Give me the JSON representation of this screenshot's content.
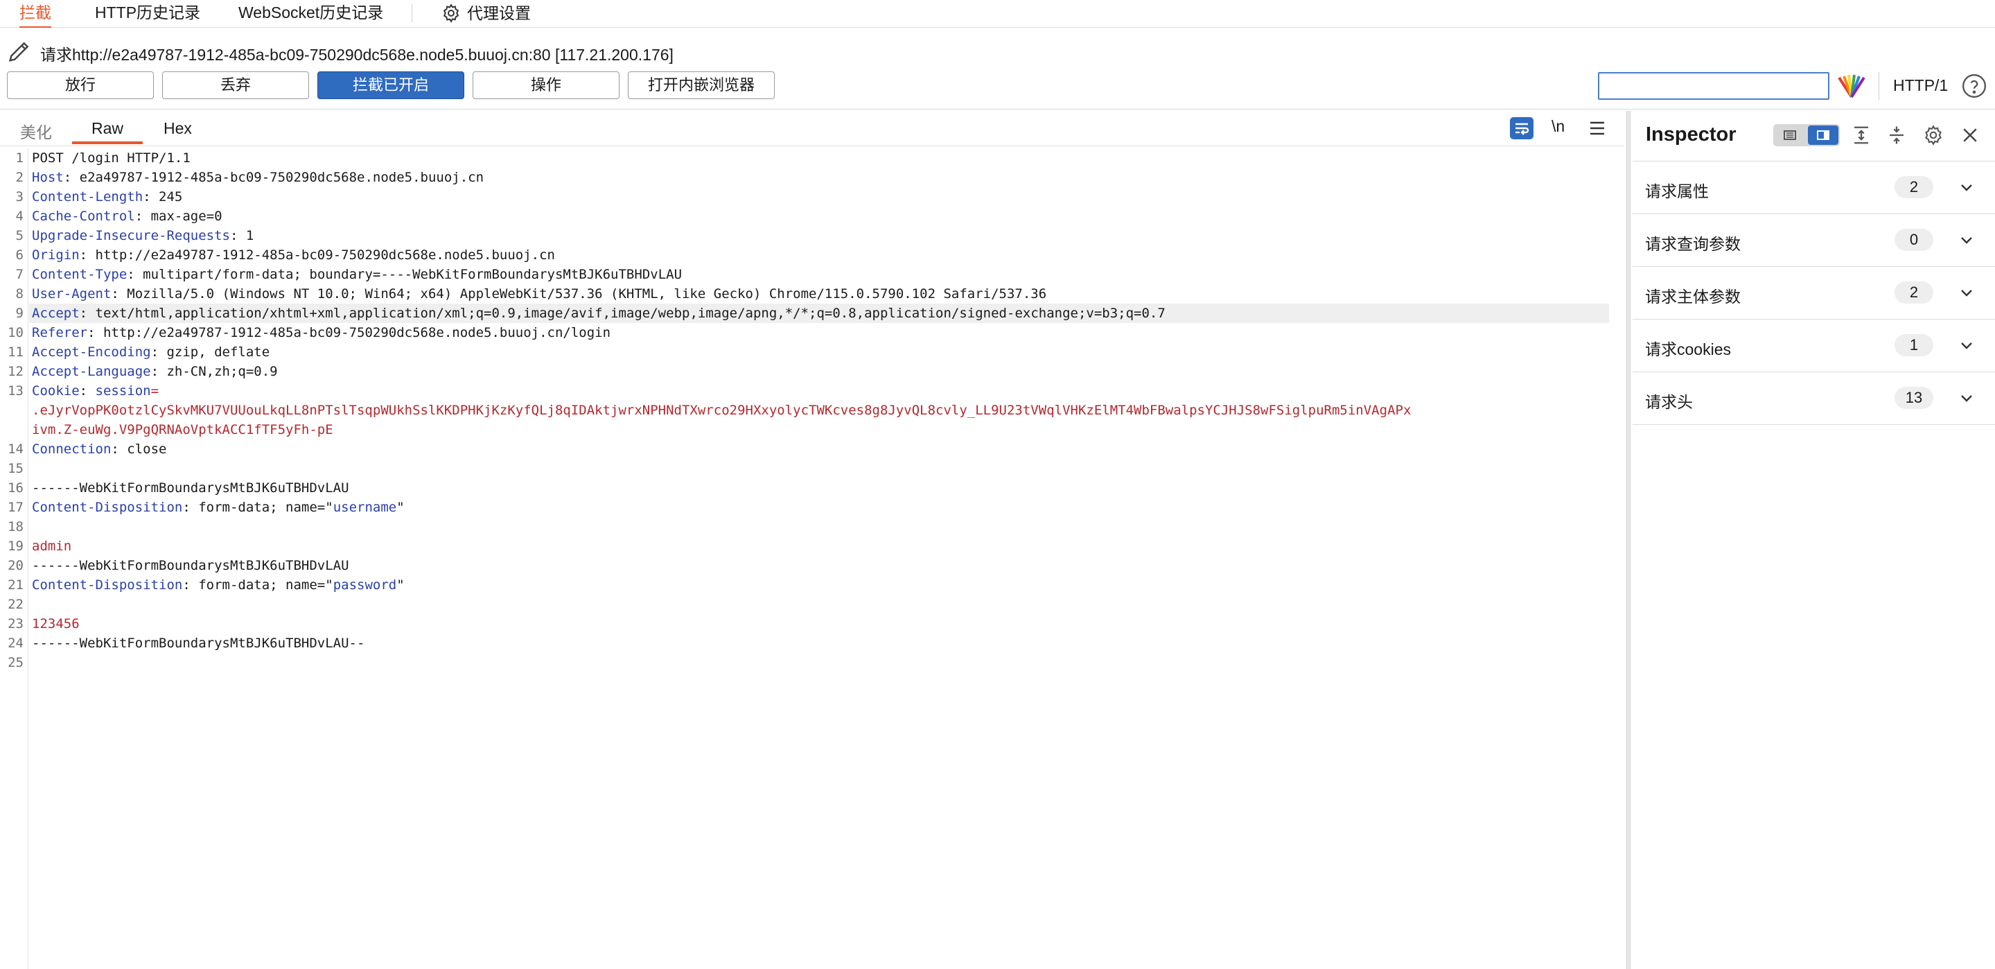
{
  "top_tabs": [
    {
      "label": "拦截",
      "active": true
    },
    {
      "label": "HTTP历史记录",
      "active": false
    },
    {
      "label": "WebSocket历史记录",
      "active": false
    },
    {
      "label": "代理设置",
      "active": false
    }
  ],
  "request": {
    "label": "请求http://e2a49787-1912-485a-bc09-750290dc568e.node5.buuoj.cn:80  [117.21.200.176]"
  },
  "toolbar": {
    "forward": "放行",
    "drop": "丢弃",
    "intercept": "拦截已开启",
    "action": "操作",
    "browser": "打开内嵌浏览器",
    "search_value": "",
    "protocol": "HTTP/1"
  },
  "editor": {
    "tabs": [
      "美化",
      "Raw",
      "Hex"
    ],
    "newline_toggle": "\\n",
    "line_numbers": [
      "1",
      "2",
      "3",
      "4",
      "5",
      "6",
      "7",
      "8",
      "9",
      "10",
      "11",
      "12",
      "13",
      "14",
      "15",
      "16",
      "17",
      "18",
      "19",
      "20",
      "21",
      "22",
      "23",
      "24",
      "25"
    ],
    "lines": {
      "l1": "POST /login HTTP/1.1",
      "l2k": "Host",
      "l2v": ": e2a49787-1912-485a-bc09-750290dc568e.node5.buuoj.cn",
      "l3k": "Content-Length",
      "l3v": ": 245",
      "l4k": "Cache-Control",
      "l4v": ": max-age=0",
      "l5k": "Upgrade-Insecure-Requests",
      "l5v": ": 1",
      "l6k": "Origin",
      "l6v": ": http://e2a49787-1912-485a-bc09-750290dc568e.node5.buuoj.cn",
      "l7k": "Content-Type",
      "l7v": ": multipart/form-data; boundary=----WebKitFormBoundarysMtBJK6uTBHDvLAU",
      "l8k": "User-Agent",
      "l8v": ": Mozilla/5.0 (Windows NT 10.0; Win64; x64) AppleWebKit/537.36 (KHTML, like Gecko) Chrome/115.0.5790.102 Safari/537.36",
      "l9k": "Accept",
      "l9v": ": text/html,application/xhtml+xml,application/xml;q=0.9,image/avif,image/webp,image/apng,*/*;q=0.8,application/signed-exchange;v=b3;q=0.7",
      "l10k": "Referer",
      "l10v": ": http://e2a49787-1912-485a-bc09-750290dc568e.node5.buuoj.cn/login",
      "l11k": "Accept-Encoding",
      "l11v": ": gzip, deflate",
      "l12k": "Accept-Language",
      "l12v": ": zh-CN,zh;q=0.9",
      "l13k": "Cookie",
      "l13s": ": ",
      "l13n": "session",
      "l13eq": "=",
      "l13a": ".eJyrVopPK0otzlCySkvMKU7VUUouLkqLL8nPTslTsqpWUkhSslKKDPHKjKzKyfQLj8qIDAktjwrxNPHNdTXwrco29HXxyolycTWKcves8g8JyvQL8cvly_LL9U23tVWqlVHKzElMT4WbFBwalpsYCJHJS8wFSiglpuRm5inVAgAPx",
      "l13b": "ivm.Z-euWg.V9PgQRNAoVptkACC1fTF5yFh-pE",
      "l14k": "Connection",
      "l14v": ": close",
      "l16": "------WebKitFormBoundarysMtBJK6uTBHDvLAU",
      "l17k": "Content-Disposition",
      "l17v": ": form-data; name=\"",
      "l17n": "username",
      "l17e": "\"",
      "l19": "admin",
      "l20": "------WebKitFormBoundarysMtBJK6uTBHDvLAU",
      "l21k": "Content-Disposition",
      "l21v": ": form-data; name=\"",
      "l21n": "password",
      "l21e": "\"",
      "l23": "123456",
      "l24": "------WebKitFormBoundarysMtBJK6uTBHDvLAU--"
    }
  },
  "inspector": {
    "title": "Inspector",
    "sections": [
      {
        "label": "请求属性",
        "count": "2"
      },
      {
        "label": "请求查询参数",
        "count": "0"
      },
      {
        "label": "请求主体参数",
        "count": "2"
      },
      {
        "label": "请求cookies",
        "count": "1"
      },
      {
        "label": "请求头",
        "count": "13"
      }
    ]
  },
  "colors": {
    "accent": "#e8582a",
    "button_on": "#2f6bbf",
    "header_key": "#2a3fa8",
    "cookie_value": "#b5282e"
  },
  "icons": [
    "gear-icon",
    "pencil-icon",
    "color-palette-icon",
    "help-icon",
    "wrap-icon",
    "menu-icon",
    "layout-list-icon",
    "layout-panel-icon",
    "expand-icon",
    "collapse-icon",
    "settings-icon",
    "close-icon",
    "chevron-down-icon"
  ]
}
